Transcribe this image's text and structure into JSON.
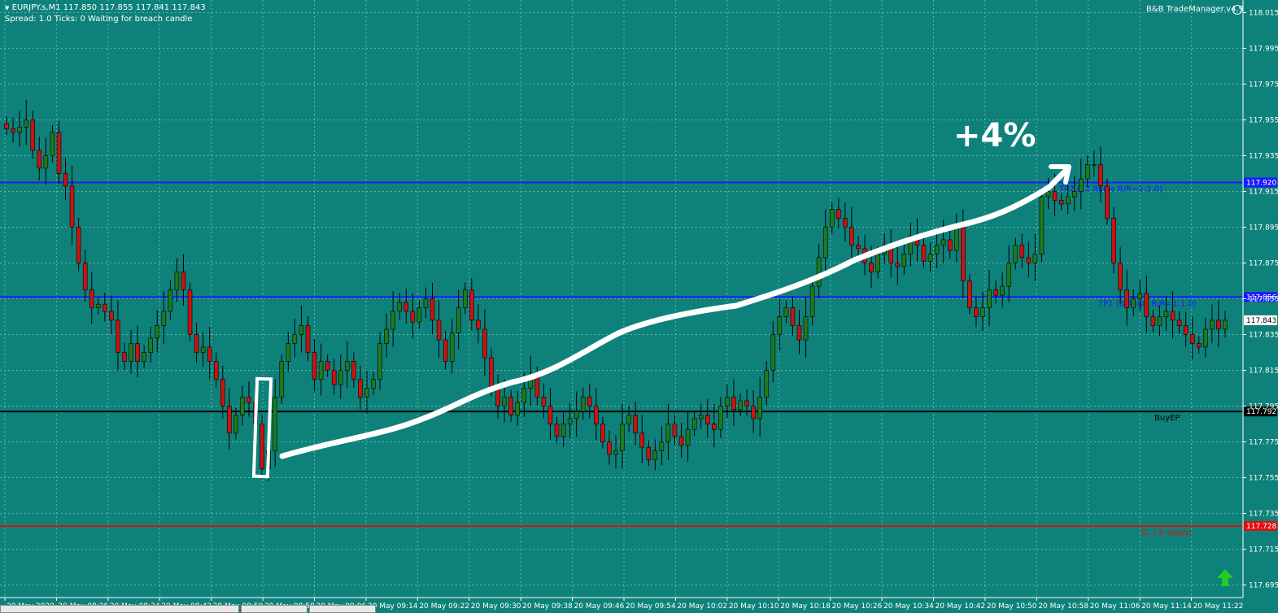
{
  "header": {
    "symbol_line": "EURJPY.s,M1  117.850 117.855 117.841 117.843",
    "status_line": "Spread: 1.0   Ticks: 0   Waiting for breach candle",
    "indicator_label": "B&B TradeManager.v4.9",
    "indicator_icon": "smiley-icon"
  },
  "annotation": {
    "gain_text": "+4%"
  },
  "levels": {
    "tp2": {
      "price": "117.920",
      "label": "TP2 (12.8pips R/R=1:2.0)",
      "color": "#1a1aff"
    },
    "tp1": {
      "price": "117.856",
      "label": "TP1 (6.4pips R/R=1:1.0)",
      "color": "#1a1aff"
    },
    "current": {
      "price": "117.843"
    },
    "entry": {
      "price": "117.792",
      "label": "BuyEP",
      "color": "#000000"
    },
    "sl": {
      "price": "117.728",
      "label": "SL (-6.4pips)",
      "color": "#e01010"
    }
  },
  "y_ticks": [
    "118.015",
    "117.995",
    "117.975",
    "117.955",
    "117.935",
    "117.915",
    "117.895",
    "117.875",
    "117.855",
    "117.835",
    "117.815",
    "117.795",
    "117.775",
    "117.755",
    "117.735",
    "117.715",
    "117.695"
  ],
  "x_ticks": [
    "20 May 2020",
    "20 May 08:26",
    "20 May 08:34",
    "20 May 08:42",
    "20 May 08:50",
    "20 May 08:58",
    "20 May 09:06",
    "20 May 09:14",
    "20 May 09:22",
    "20 May 09:30",
    "20 May 09:38",
    "20 May 09:46",
    "20 May 09:54",
    "20 May 10:02",
    "20 May 10:10",
    "20 May 10:18",
    "20 May 10:26",
    "20 May 10:34",
    "20 May 10:42",
    "20 May 10:50",
    "20 May 10:58",
    "20 May 11:06",
    "20 May 11:14",
    "20 May 11:22"
  ],
  "colors": {
    "background": "#0e827a",
    "bull": "#1f7a1f",
    "bear": "#c81414",
    "grid": "#5fb5ad",
    "trend_arrow": "#ffffff"
  },
  "chart_data": {
    "type": "candlestick",
    "ylim": [
      117.688,
      118.022
    ],
    "candles_close": [
      117.95,
      117.948,
      117.951,
      117.955,
      117.938,
      117.928,
      117.935,
      117.948,
      117.925,
      117.918,
      117.895,
      117.875,
      117.86,
      117.85,
      117.852,
      117.848,
      117.843,
      117.825,
      117.82,
      117.83,
      117.82,
      117.825,
      117.833,
      117.84,
      117.848,
      117.86,
      117.87,
      117.86,
      117.835,
      117.825,
      117.828,
      117.82,
      117.81,
      117.795,
      117.78,
      117.79,
      117.8,
      117.797,
      117.785,
      117.76,
      117.77,
      117.8,
      117.82,
      117.83,
      117.835,
      117.84,
      117.825,
      117.81,
      117.82,
      117.815,
      117.807,
      117.815,
      117.82,
      117.81,
      117.8,
      117.805,
      117.81,
      117.83,
      117.838,
      117.848,
      117.853,
      117.848,
      117.842,
      117.85,
      117.855,
      117.843,
      117.832,
      117.82,
      117.836,
      117.85,
      117.86,
      117.843,
      117.838,
      117.822,
      117.805,
      117.795,
      117.8,
      117.79,
      117.797,
      117.805,
      117.812,
      117.8,
      117.795,
      117.785,
      117.778,
      117.785,
      117.788,
      117.792,
      117.8,
      117.795,
      117.785,
      117.775,
      117.768,
      117.77,
      117.785,
      117.79,
      117.78,
      117.772,
      117.765,
      117.77,
      117.775,
      117.785,
      117.778,
      117.773,
      117.782,
      117.788,
      117.79,
      117.785,
      117.782,
      117.795,
      117.8,
      117.793,
      117.798,
      117.795,
      117.788,
      117.8,
      117.815,
      117.835,
      117.845,
      117.85,
      117.84,
      117.832,
      117.845,
      117.862,
      117.878,
      117.895,
      117.905,
      117.9,
      117.895,
      117.885,
      117.883,
      117.875,
      117.87,
      117.88,
      117.885,
      117.875,
      117.873,
      117.88,
      117.89,
      117.885,
      117.876,
      117.88,
      117.885,
      117.888,
      117.882,
      117.895,
      117.865,
      117.85,
      117.845,
      117.85,
      117.86,
      117.857,
      117.862,
      117.875,
      117.885,
      117.878,
      117.875,
      117.88,
      117.912,
      117.915,
      117.91,
      117.908,
      117.912,
      117.915,
      117.922,
      117.93,
      117.93,
      117.918,
      117.9,
      117.875,
      117.86,
      117.85,
      117.855,
      117.858,
      117.845,
      117.84,
      117.845,
      117.848,
      117.843,
      117.84,
      117.835,
      117.83,
      117.828,
      117.838,
      117.843,
      117.838,
      117.843
    ]
  }
}
